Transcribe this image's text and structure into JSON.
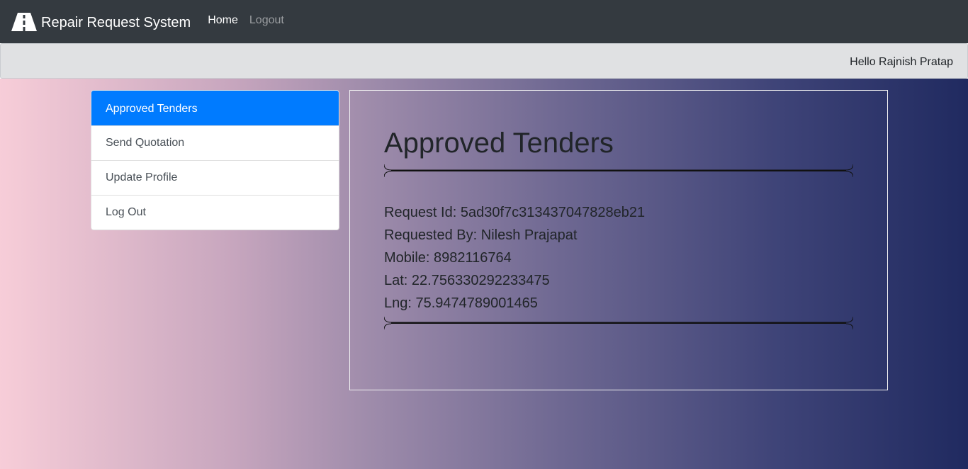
{
  "navbar": {
    "brand": "Repair Request System",
    "logo_icon": "road-icon",
    "links": [
      {
        "label": "Home",
        "active": true
      },
      {
        "label": "Logout",
        "active": false
      }
    ]
  },
  "subbar": {
    "greeting": "Hello Rajnish Pratap"
  },
  "sidebar": {
    "items": [
      {
        "label": "Approved Tenders",
        "active": true
      },
      {
        "label": "Send Quotation",
        "active": false
      },
      {
        "label": "Update Profile",
        "active": false
      },
      {
        "label": "Log Out",
        "active": false
      }
    ]
  },
  "main": {
    "title": "Approved Tenders",
    "details": [
      "Request Id: 5ad30f7c313437047828eb21",
      "Requested By: Nilesh Prajapat",
      "Mobile: 8982116764",
      "Lat: 22.756330292233475",
      "Lng: 75.9474789001465"
    ]
  },
  "colors": {
    "navbar": "#343a40",
    "active_blue": "#007bff",
    "gradient_start": "#f7cdd8",
    "gradient_end": "#202a60"
  }
}
